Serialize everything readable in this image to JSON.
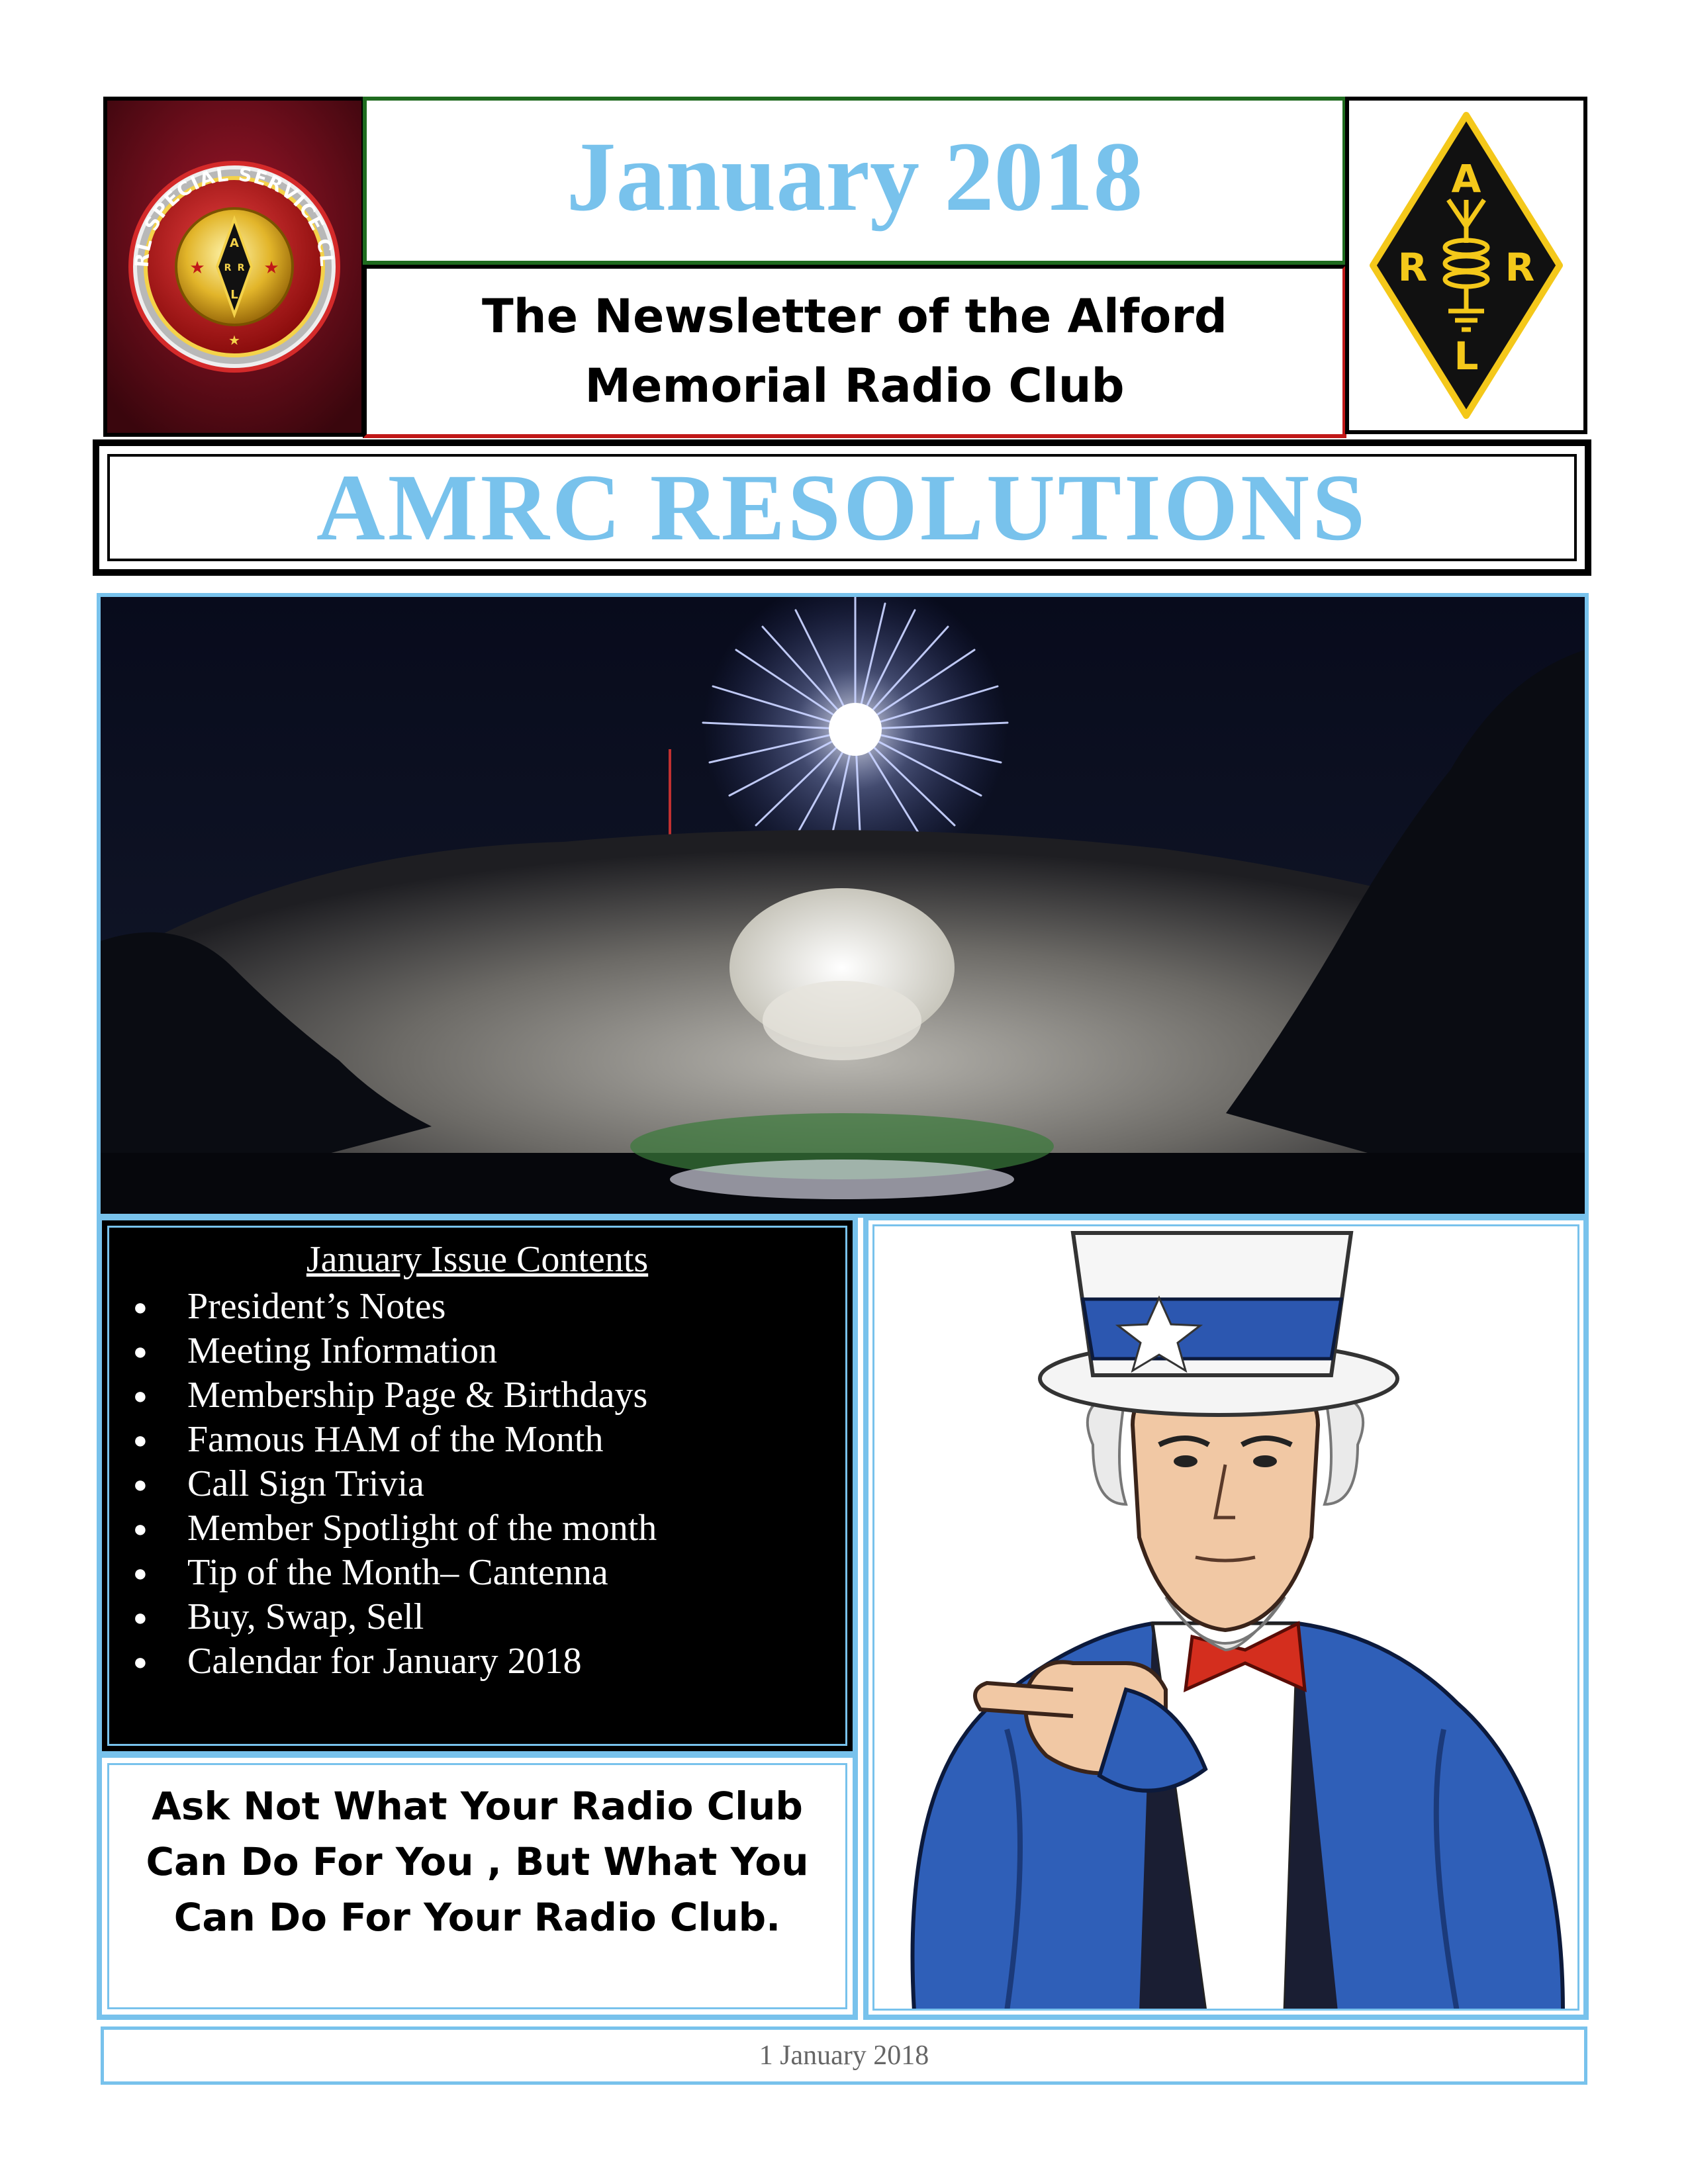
{
  "header": {
    "title": "January 2018",
    "subtitle_line1": "The Newsletter of the Alford",
    "subtitle_line2": "Memorial Radio Club",
    "left_logo": {
      "icon": "arrl-special-service-club-seal",
      "ring_text": "ARRL SPECIAL SERVICE CLUB"
    },
    "right_logo": {
      "icon": "arrl-diamond-logo",
      "letters": [
        "A",
        "R",
        "R",
        "L"
      ]
    }
  },
  "banner": {
    "text": "AMRC RESOLUTIONS"
  },
  "photo": {
    "icon": "stone-mountain-fireworks-photo"
  },
  "contents": {
    "heading": "January Issue Contents",
    "items": [
      "President’s Notes",
      "Meeting Information",
      "Membership Page & Birthdays",
      "Famous HAM of the Month",
      "Call Sign Trivia",
      "Member Spotlight of the month",
      "Tip of the Month– Cantenna",
      "Buy, Swap, Sell",
      "Calendar for January 2018"
    ]
  },
  "slogan": {
    "line1": "Ask Not What Your Radio Club",
    "line2": "Can Do For You , But What You",
    "line3": "Can Do For Your Radio Club."
  },
  "illustration": {
    "icon": "uncle-sam-pointing-illustration"
  },
  "footer": {
    "text": "1 January 2018"
  },
  "colors": {
    "accent_blue": "#78c2ec",
    "maroon": "#6b0f1c",
    "green_border": "#1f6b1f",
    "red_border": "#c01818"
  }
}
